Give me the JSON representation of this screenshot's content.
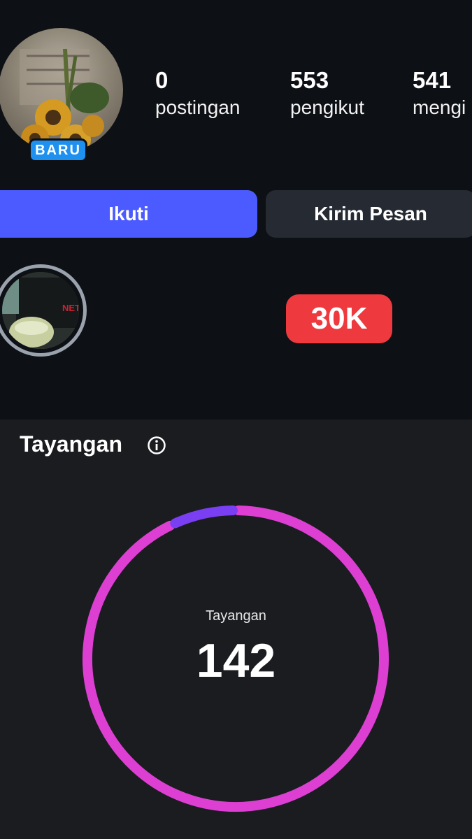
{
  "profile": {
    "badge": "BARU",
    "stats": [
      {
        "value": "0",
        "label": "postingan"
      },
      {
        "value": "553",
        "label": "pengikut"
      },
      {
        "value": "541",
        "label": "mengi"
      }
    ],
    "follow_label": "Ikuti",
    "message_label": "Kirim Pesan",
    "highlight_overlay_text": "NETFL",
    "highlight_count": "30K"
  },
  "insights": {
    "title": "Tayangan",
    "info_icon": "info-icon",
    "donut_label": "Tayangan",
    "donut_value": "142",
    "segments": [
      {
        "name": "",
        "fraction": 0.93,
        "color": "#dd3fd3"
      },
      {
        "name": "",
        "fraction": 0.07,
        "color": "#7a3ff3"
      }
    ]
  },
  "colors": {
    "follow_button": "#4c5bff",
    "message_button": "#262a33",
    "badge": "#1e90f0",
    "count_pill": "#ee3a3f"
  }
}
